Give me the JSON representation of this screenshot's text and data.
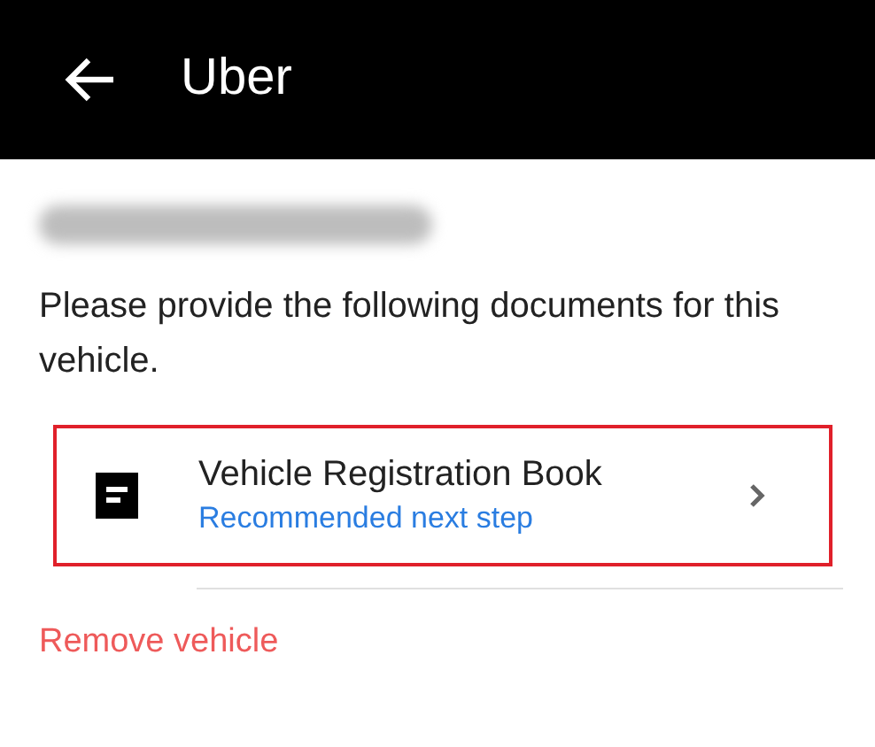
{
  "header": {
    "title": "Uber"
  },
  "instructions": "Please provide the following documents for this vehicle.",
  "documents": [
    {
      "title": "Vehicle Registration Book",
      "subtitle": "Recommended next step",
      "highlighted": true
    }
  ],
  "actions": {
    "remove": "Remove vehicle"
  }
}
